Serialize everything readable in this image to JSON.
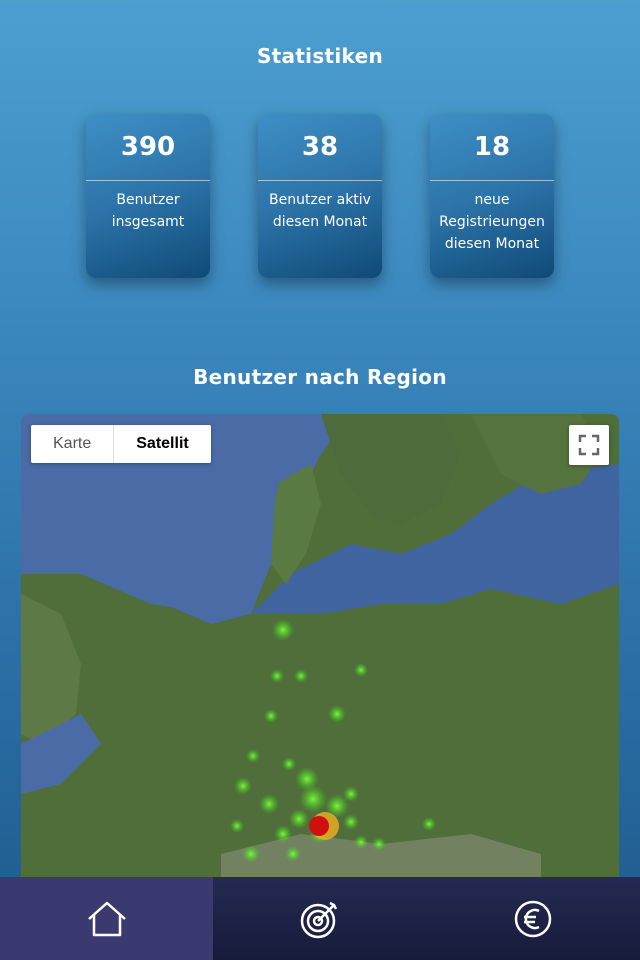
{
  "stats": {
    "title": "Statistiken",
    "cards": [
      {
        "value": "390",
        "label": "Benutzer insgesamt"
      },
      {
        "value": "38",
        "label": "Benutzer aktiv diesen Monat"
      },
      {
        "value": "18",
        "label": "neue Registrieungen diesen Monat"
      }
    ]
  },
  "region": {
    "title": "Benutzer nach Region",
    "map_types": [
      "Karte",
      "Satellit"
    ],
    "selected_map_type": "Satellit"
  },
  "nav": {
    "items": [
      {
        "icon": "home-icon",
        "active": true
      },
      {
        "icon": "target-icon",
        "active": false
      },
      {
        "icon": "euro-icon",
        "active": false
      }
    ]
  },
  "colors": {
    "accent": "#3a86bd",
    "nav_bg": "#1b1f40",
    "nav_active": "#3a3a70",
    "heat_high": "#d01010",
    "heat_low": "#55e030"
  }
}
